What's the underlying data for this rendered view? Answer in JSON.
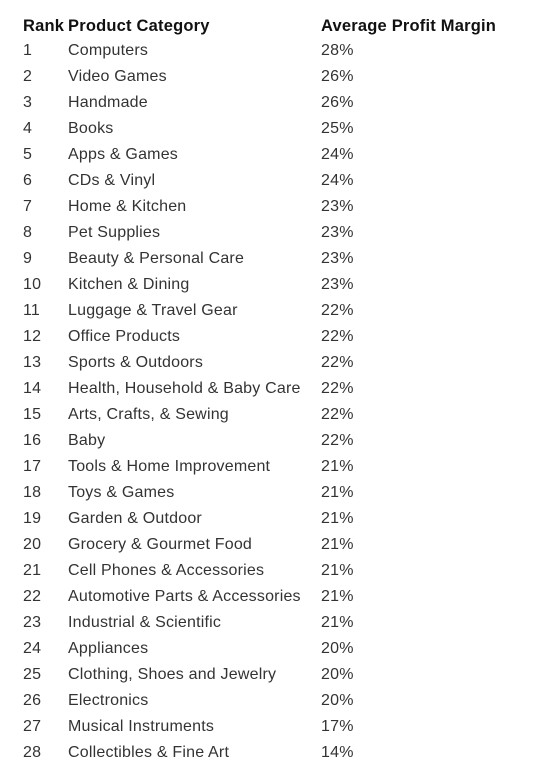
{
  "table": {
    "headers": {
      "rank": "Rank",
      "category": "Product Category",
      "margin": "Average Profit Margin"
    },
    "rows": [
      {
        "rank": "1",
        "category": "Computers",
        "margin": "28%"
      },
      {
        "rank": "2",
        "category": "Video Games",
        "margin": "26%"
      },
      {
        "rank": "3",
        "category": "Handmade",
        "margin": "26%"
      },
      {
        "rank": "4",
        "category": "Books",
        "margin": "25%"
      },
      {
        "rank": "5",
        "category": "Apps & Games",
        "margin": "24%"
      },
      {
        "rank": "6",
        "category": "CDs & Vinyl",
        "margin": "24%"
      },
      {
        "rank": "7",
        "category": "Home & Kitchen",
        "margin": "23%"
      },
      {
        "rank": "8",
        "category": "Pet Supplies",
        "margin": "23%"
      },
      {
        "rank": "9",
        "category": "Beauty & Personal Care",
        "margin": "23%"
      },
      {
        "rank": "10",
        "category": "Kitchen & Dining",
        "margin": "23%"
      },
      {
        "rank": "11",
        "category": "Luggage & Travel Gear",
        "margin": "22%"
      },
      {
        "rank": "12",
        "category": "Office Products",
        "margin": "22%"
      },
      {
        "rank": "13",
        "category": "Sports & Outdoors",
        "margin": "22%"
      },
      {
        "rank": "14",
        "category": "Health, Household & Baby Care",
        "margin": "22%"
      },
      {
        "rank": "15",
        "category": "Arts, Crafts, & Sewing",
        "margin": "22%"
      },
      {
        "rank": "16",
        "category": "Baby",
        "margin": "22%"
      },
      {
        "rank": "17",
        "category": "Tools & Home Improvement",
        "margin": "21%"
      },
      {
        "rank": "18",
        "category": "Toys & Games",
        "margin": "21%"
      },
      {
        "rank": "19",
        "category": "Garden & Outdoor",
        "margin": "21%"
      },
      {
        "rank": "20",
        "category": "Grocery & Gourmet Food",
        "margin": "21%"
      },
      {
        "rank": "21",
        "category": "Cell Phones & Accessories",
        "margin": "21%"
      },
      {
        "rank": "22",
        "category": "Automotive Parts & Accessories",
        "margin": "21%"
      },
      {
        "rank": "23",
        "category": "Industrial & Scientific",
        "margin": "21%"
      },
      {
        "rank": "24",
        "category": "Appliances",
        "margin": "20%"
      },
      {
        "rank": "25",
        "category": "Clothing, Shoes and Jewelry",
        "margin": "20%"
      },
      {
        "rank": "26",
        "category": "Electronics",
        "margin": "20%"
      },
      {
        "rank": "27",
        "category": "Musical Instruments",
        "margin": "17%"
      },
      {
        "rank": "28",
        "category": "Collectibles & Fine Art",
        "margin": "14%"
      }
    ]
  }
}
